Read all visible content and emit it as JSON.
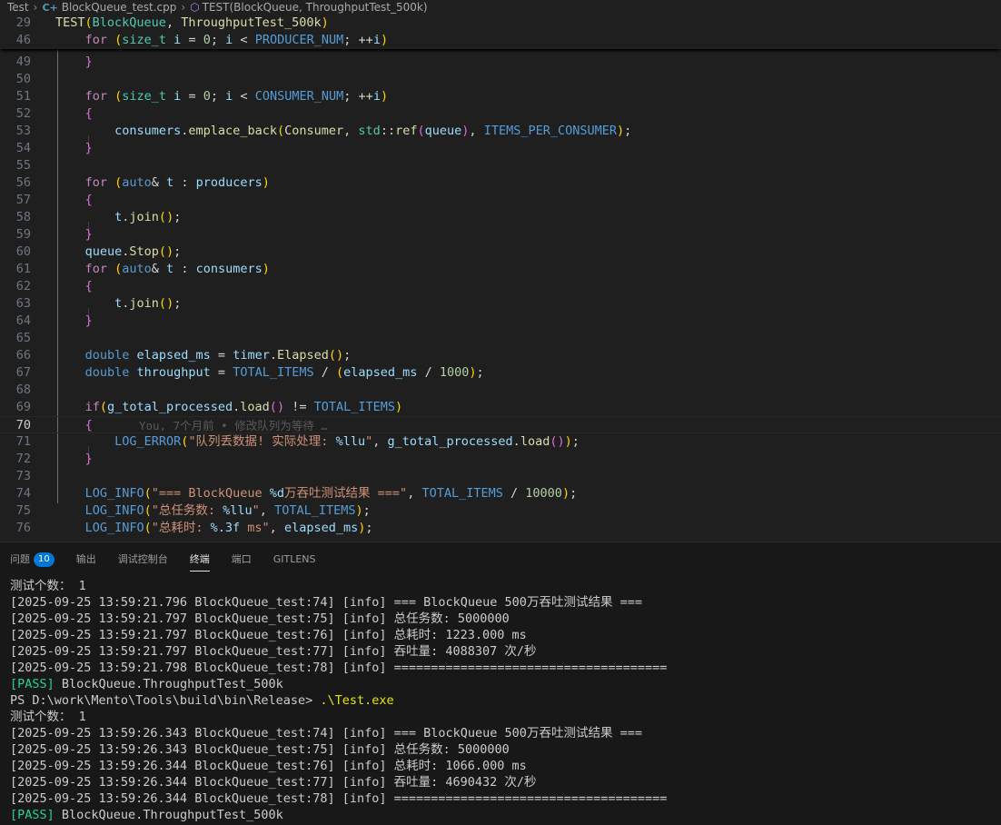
{
  "breadcrumb": {
    "root": "Test",
    "file": "BlockQueue_test.cpp",
    "file_icon": "cpp-file-icon",
    "symbol": "TEST(BlockQueue, ThroughputTest_500k)",
    "symbol_icon": "cube-icon"
  },
  "editor": {
    "sticky": [
      {
        "num": "29",
        "text": "TEST(BlockQueue, ThroughputTest_500k)"
      },
      {
        "num": "46",
        "text": "    for (size_t i = 0; i < PRODUCER_NUM; ++i)"
      }
    ],
    "lines": [
      {
        "num": "49",
        "text": "    }"
      },
      {
        "num": "50",
        "text": ""
      },
      {
        "num": "51",
        "text": "    for (size_t i = 0; i < CONSUMER_NUM; ++i)"
      },
      {
        "num": "52",
        "text": "    {"
      },
      {
        "num": "53",
        "text": "        consumers.emplace_back(Consumer, std::ref(queue), ITEMS_PER_CONSUMER);"
      },
      {
        "num": "54",
        "text": "    }"
      },
      {
        "num": "55",
        "text": ""
      },
      {
        "num": "56",
        "text": "    for (auto& t : producers)"
      },
      {
        "num": "57",
        "text": "    {"
      },
      {
        "num": "58",
        "text": "        t.join();"
      },
      {
        "num": "59",
        "text": "    }"
      },
      {
        "num": "60",
        "text": "    queue.Stop();"
      },
      {
        "num": "61",
        "text": "    for (auto& t : consumers)"
      },
      {
        "num": "62",
        "text": "    {"
      },
      {
        "num": "63",
        "text": "        t.join();"
      },
      {
        "num": "64",
        "text": "    }"
      },
      {
        "num": "65",
        "text": ""
      },
      {
        "num": "66",
        "text": "    double elapsed_ms = timer.Elapsed();"
      },
      {
        "num": "67",
        "text": "    double throughput = TOTAL_ITEMS / (elapsed_ms / 1000);"
      },
      {
        "num": "68",
        "text": ""
      },
      {
        "num": "69",
        "text": "    if(g_total_processed.load() != TOTAL_ITEMS)"
      },
      {
        "num": "70",
        "text": "    {"
      },
      {
        "num": "71",
        "text": "        LOG_ERROR(\"队列丢数据! 实际处理: %llu\", g_total_processed.load());"
      },
      {
        "num": "72",
        "text": "    }"
      },
      {
        "num": "73",
        "text": ""
      },
      {
        "num": "74",
        "text": "    LOG_INFO(\"=== BlockQueue %d万吞吐测试结果 ===\", TOTAL_ITEMS / 10000);"
      },
      {
        "num": "75",
        "text": "    LOG_INFO(\"总任务数: %llu\", TOTAL_ITEMS);"
      },
      {
        "num": "76",
        "text": "    LOG_INFO(\"总耗时: %.3f ms\", elapsed_ms);"
      }
    ],
    "current_line": "70",
    "blame": "You, 7个月前 • 修改队列为等待 …"
  },
  "panel": {
    "tabs": [
      {
        "label": "问题",
        "badge": "10"
      },
      {
        "label": "输出"
      },
      {
        "label": "调试控制台"
      },
      {
        "label": "终端",
        "active": true
      },
      {
        "label": "端口"
      },
      {
        "label": "GITLENS"
      }
    ],
    "terminal": [
      {
        "text": "测试个数： 1"
      },
      {
        "text": "[2025-09-25 13:59:21.796 BlockQueue_test:74] [info] === BlockQueue 500万吞吐测试结果 ==="
      },
      {
        "text": "[2025-09-25 13:59:21.797 BlockQueue_test:75] [info] 总任务数: 5000000"
      },
      {
        "text": "[2025-09-25 13:59:21.797 BlockQueue_test:76] [info] 总耗时: 1223.000 ms"
      },
      {
        "text": "[2025-09-25 13:59:21.797 BlockQueue_test:77] [info] 吞吐量: 4088307 次/秒"
      },
      {
        "text": "[2025-09-25 13:59:21.798 BlockQueue_test:78] [info] ====================================="
      },
      {
        "tag": "[PASS]",
        "text": " BlockQueue.ThroughputTest_500k"
      },
      {
        "prompt": "PS D:\\work\\Mento\\Tools\\build\\bin\\Release> ",
        "cmd": ".\\Test.exe"
      },
      {
        "text": "测试个数： 1"
      },
      {
        "text": "[2025-09-25 13:59:26.343 BlockQueue_test:74] [info] === BlockQueue 500万吞吐测试结果 ==="
      },
      {
        "text": "[2025-09-25 13:59:26.343 BlockQueue_test:75] [info] 总任务数: 5000000"
      },
      {
        "text": "[2025-09-25 13:59:26.344 BlockQueue_test:76] [info] 总耗时: 1066.000 ms"
      },
      {
        "text": "[2025-09-25 13:59:26.344 BlockQueue_test:77] [info] 吞吐量: 4690432 次/秒"
      },
      {
        "text": "[2025-09-25 13:59:26.344 BlockQueue_test:78] [info] ====================================="
      },
      {
        "tag": "[PASS]",
        "text": " BlockQueue.ThroughputTest_500k"
      }
    ]
  }
}
